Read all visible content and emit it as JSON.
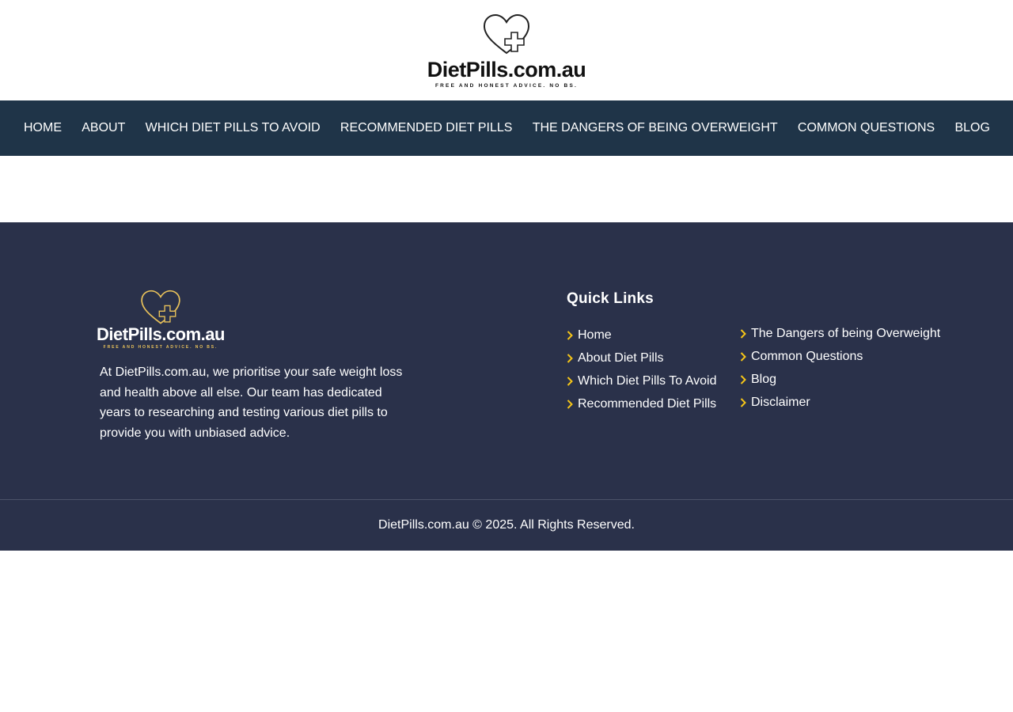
{
  "header": {
    "logo_name": "DietPills.com.au",
    "logo_tagline": "FREE AND HONEST ADVICE. NO BS."
  },
  "nav": {
    "items": [
      {
        "label": "HOME"
      },
      {
        "label": "ABOUT"
      },
      {
        "label": "WHICH DIET PILLS TO AVOID"
      },
      {
        "label": "RECOMMENDED DIET PILLS"
      },
      {
        "label": "THE DANGERS OF BEING OVERWEIGHT"
      },
      {
        "label": "COMMON QUESTIONS"
      },
      {
        "label": "BLOG"
      }
    ]
  },
  "footer": {
    "logo_name": "DietPills.com.au",
    "logo_tagline": "FREE AND HONEST ADVICE. NO BS.",
    "description": "At DietPills.com.au, we prioritise your safe weight loss and health above all else. Our team has dedicated years to researching and testing various diet pills to provide you with unbiased advice.",
    "quick_links_title": "Quick Links",
    "links_col1": [
      {
        "label": "Home"
      },
      {
        "label": "About Diet Pills"
      },
      {
        "label": "Which Diet Pills To Avoid"
      },
      {
        "label": "Recommended Diet Pills"
      }
    ],
    "links_col2": [
      {
        "label": "The Dangers of being Overweight"
      },
      {
        "label": "Common Questions"
      },
      {
        "label": "Blog"
      },
      {
        "label": "Disclaimer"
      }
    ],
    "copyright": "DietPills.com.au © 2025. All Rights Reserved."
  },
  "icons": {
    "logo": "heart-cross-icon",
    "link_bullet": "chevron-right-icon"
  },
  "colors": {
    "nav_bg": "#1f3448",
    "footer_bg": "#2a314a",
    "accent": "#f5c518"
  }
}
